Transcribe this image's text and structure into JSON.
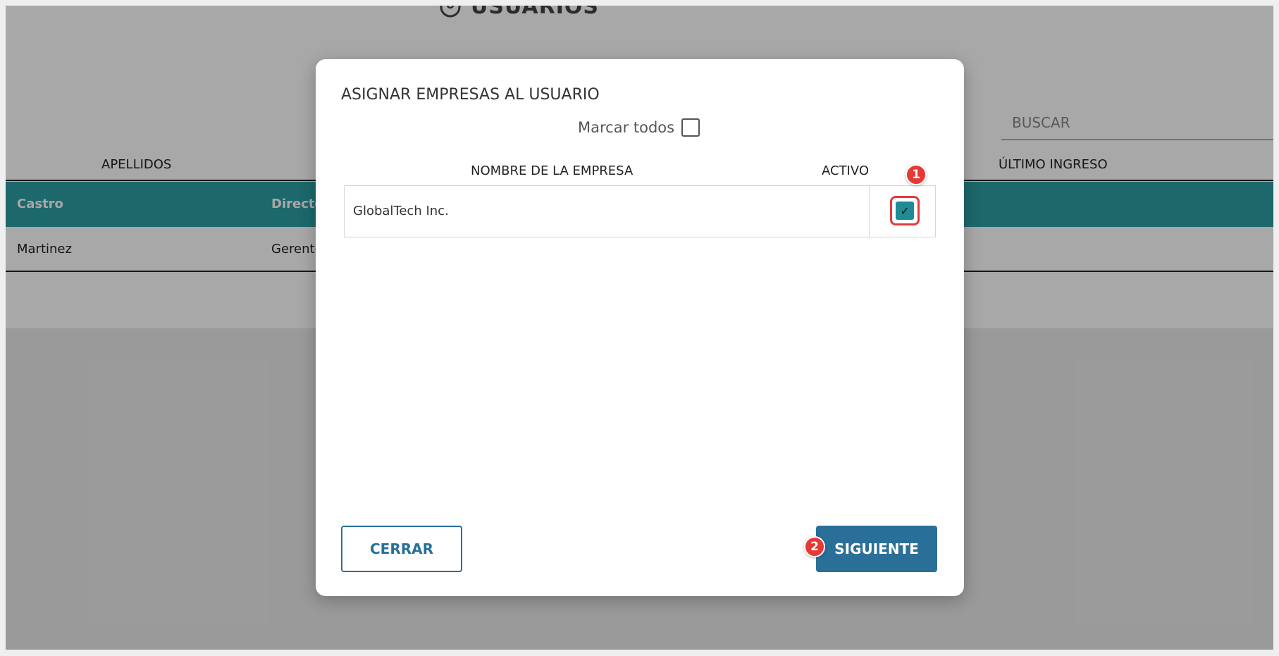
{
  "page": {
    "title": "USUARIOS",
    "search_placeholder": "BUSCAR"
  },
  "table": {
    "headers": {
      "surnames": "APELLIDOS",
      "last_login": "ÚLTIMO INGRESO"
    },
    "rows": [
      {
        "surname": "Castro",
        "role": "Directo",
        "selected": true
      },
      {
        "surname": "Martinez",
        "role": "Gerente",
        "selected": false
      }
    ]
  },
  "modal": {
    "title": "ASIGNAR EMPRESAS AL USUARIO",
    "mark_all_label": "Marcar todos",
    "mark_all_checked": false,
    "columns": {
      "company_name": "NOMBRE DE LA EMPRESA",
      "active": "ACTIVO"
    },
    "companies": [
      {
        "name": "GlobalTech Inc.",
        "active": true
      }
    ],
    "buttons": {
      "close": "CERRAR",
      "next": "SIGUIENTE"
    }
  },
  "annotations": {
    "step_1": "1",
    "step_2": "2"
  },
  "colors": {
    "accent_teal": "#2b9ea3",
    "checkbox_teal": "#1f8c93",
    "primary_button": "#2a6f98",
    "annotation_red": "#e53935"
  }
}
